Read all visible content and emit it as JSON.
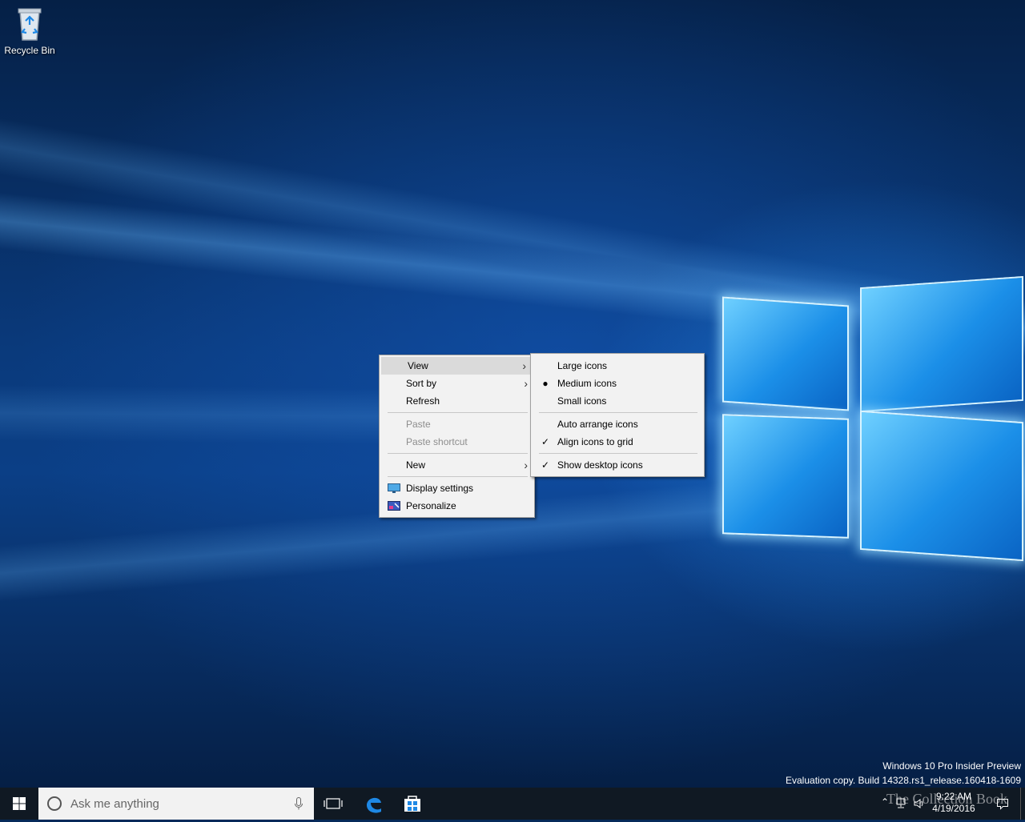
{
  "desktop": {
    "icons": [
      {
        "label": "Recycle Bin",
        "icon": "recycle-bin-icon"
      }
    ],
    "watermark": {
      "line1": "Windows 10 Pro Insider Preview",
      "line2": "Evaluation copy. Build 14328.rs1_release.160418-1609"
    }
  },
  "context_menu": {
    "items": [
      {
        "label": "View",
        "submenu": true,
        "highlighted": true
      },
      {
        "label": "Sort by",
        "submenu": true
      },
      {
        "label": "Refresh"
      },
      {
        "label": "Paste",
        "disabled": true
      },
      {
        "label": "Paste shortcut",
        "disabled": true
      },
      {
        "label": "New",
        "submenu": true
      },
      {
        "label": "Display settings",
        "icon": "display-settings-icon"
      },
      {
        "label": "Personalize",
        "icon": "personalize-icon"
      }
    ]
  },
  "view_submenu": {
    "items": [
      {
        "label": "Large icons"
      },
      {
        "label": "Medium icons",
        "selected": true
      },
      {
        "label": "Small icons"
      },
      {
        "label": "Auto arrange icons"
      },
      {
        "label": "Align icons to grid",
        "checked": true
      },
      {
        "label": "Show desktop icons",
        "checked": true
      }
    ]
  },
  "taskbar": {
    "search_placeholder": "Ask me anything",
    "pinned": [
      "task-view-icon",
      "edge-icon",
      "store-icon"
    ],
    "clock": {
      "time": "9:22 AM",
      "date": "4/19/2016"
    },
    "overlay_text": "The Collection Book"
  },
  "colors": {
    "accent": "#0078d7",
    "taskbar": "#101923",
    "menu_bg": "#f2f2f2"
  }
}
